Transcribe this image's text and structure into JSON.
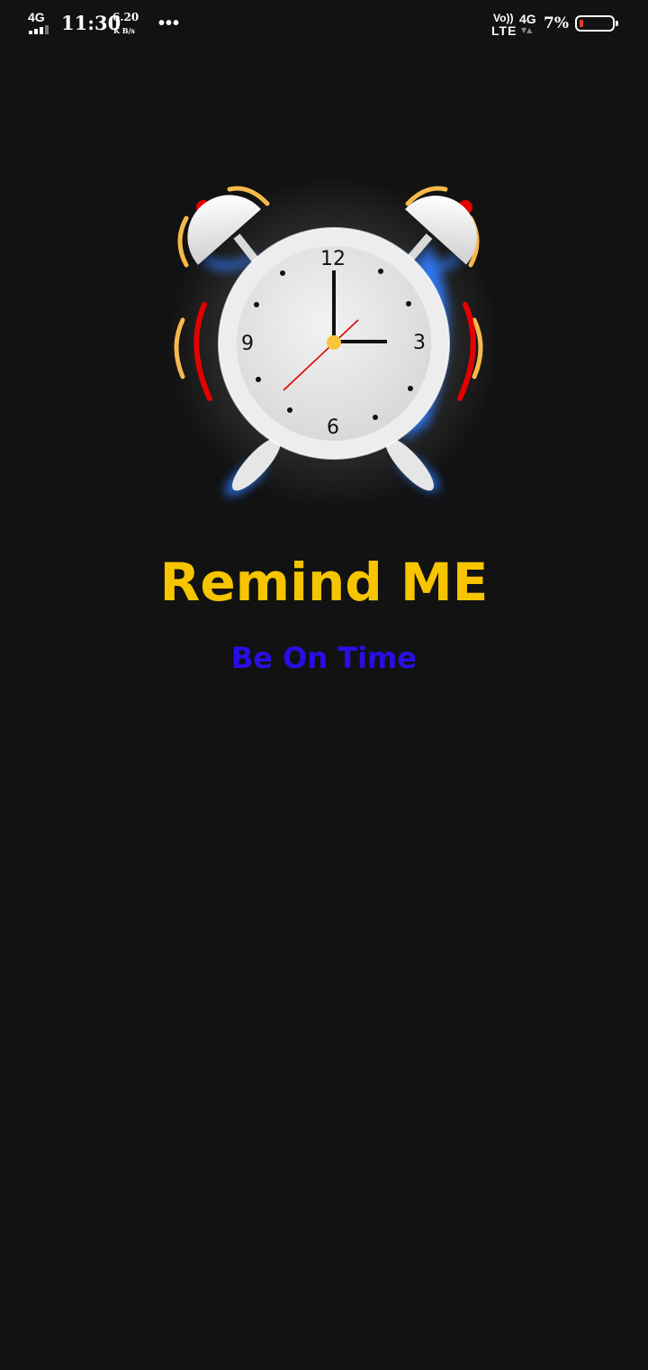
{
  "status_bar": {
    "network_left": "4G",
    "time": "11:30",
    "speed_value": "6.20",
    "speed_unit": "K B/s",
    "more": "•••",
    "volte_top": "Vo))",
    "volte_bottom": "LTE",
    "network_right": "4G",
    "battery_percent": "7%",
    "battery_level": 0.07,
    "battery_color": "#e53935"
  },
  "splash": {
    "clock_icon": "alarm-clock-icon",
    "clock_numerals": {
      "twelve": "12",
      "three": "3",
      "six": "6",
      "nine": "9"
    },
    "title": "Remind ME",
    "subtitle": "Be On Time",
    "title_color": "#f7c500",
    "subtitle_color": "#2a0ee6",
    "background_color": "#121212"
  }
}
